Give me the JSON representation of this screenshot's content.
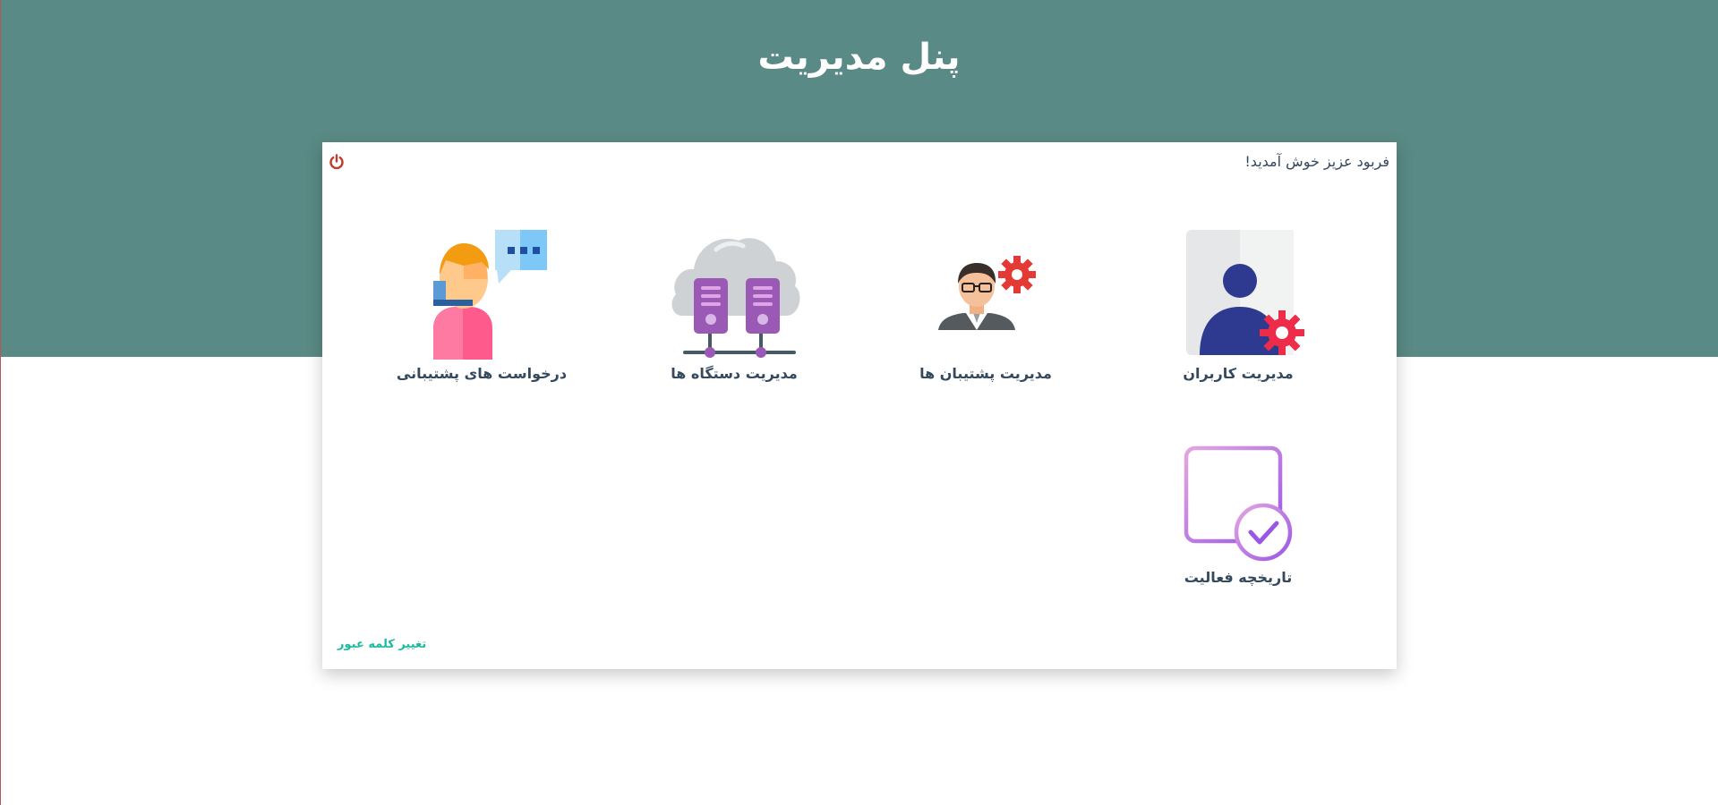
{
  "page": {
    "title": "پنل مدیریت"
  },
  "panel": {
    "welcome_text": "فربود عزیز خوش آمدید!",
    "logout_icon": "power-icon",
    "tiles": [
      {
        "label": "مدیریت کاربران",
        "icon": "user-settings-icon"
      },
      {
        "label": "مدیریت پشتیبان ها",
        "icon": "support-agent-gear-icon"
      },
      {
        "label": "مدیریت دستگاه ها",
        "icon": "cloud-servers-icon"
      },
      {
        "label": "درخواست های پشتیبانی",
        "icon": "support-chat-icon"
      },
      {
        "label": "تاریخچه فعالیت",
        "icon": "calendar-check-icon"
      }
    ],
    "change_password_link": "تغییر کلمه عبور"
  },
  "colors": {
    "header_band": "#5a8a85",
    "title_text": "#ffffff",
    "label_text": "#34495e",
    "link": "#1abc9c",
    "logout": "#c0392b"
  }
}
